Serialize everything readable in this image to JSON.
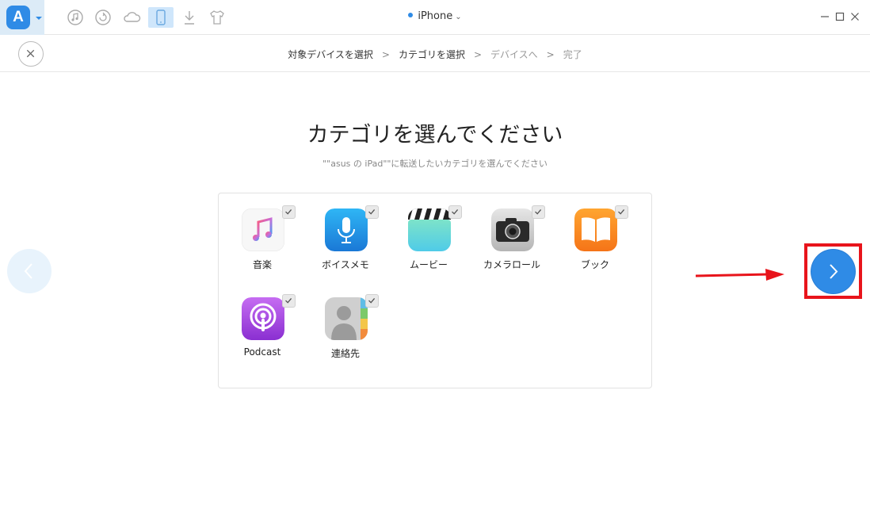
{
  "titlebar": {
    "app_logo_letter": "A",
    "device_name": "iPhone",
    "toolbar_icons": [
      "music-icon",
      "restore-icon",
      "cloud-icon",
      "device-icon",
      "download-icon",
      "shirt-icon"
    ],
    "window_controls": [
      "minimize-icon",
      "maximize-icon",
      "close-icon"
    ],
    "accent_color": "#2f8be6"
  },
  "breadcrumb": {
    "steps": [
      {
        "label": "対象デバイスを選択",
        "state": "done"
      },
      {
        "label": "カテゴリを選択",
        "state": "done"
      },
      {
        "label": "デバイスへ",
        "state": "todo"
      },
      {
        "label": "完了",
        "state": "todo"
      }
    ],
    "separator": ">"
  },
  "main": {
    "heading": "カテゴリを選んでください",
    "subheading": "\"\"asus の iPad\"\"に転送したいカテゴリを選んでください"
  },
  "categories": [
    {
      "label": "音楽",
      "icon": "music-app-icon",
      "checked": true
    },
    {
      "label": "ボイスメモ",
      "icon": "voice-memo-icon",
      "checked": true
    },
    {
      "label": "ムービー",
      "icon": "movie-clapper-icon",
      "checked": true
    },
    {
      "label": "カメラロール",
      "icon": "camera-icon",
      "checked": true
    },
    {
      "label": "ブック",
      "icon": "books-icon",
      "checked": true
    },
    {
      "label": "Podcast",
      "icon": "podcast-icon",
      "checked": true
    },
    {
      "label": "連絡先",
      "icon": "contacts-icon",
      "checked": true
    }
  ],
  "navigation": {
    "prev_icon": "chevron-left-icon",
    "next_icon": "chevron-right-icon",
    "highlight_color": "#e8141b"
  }
}
